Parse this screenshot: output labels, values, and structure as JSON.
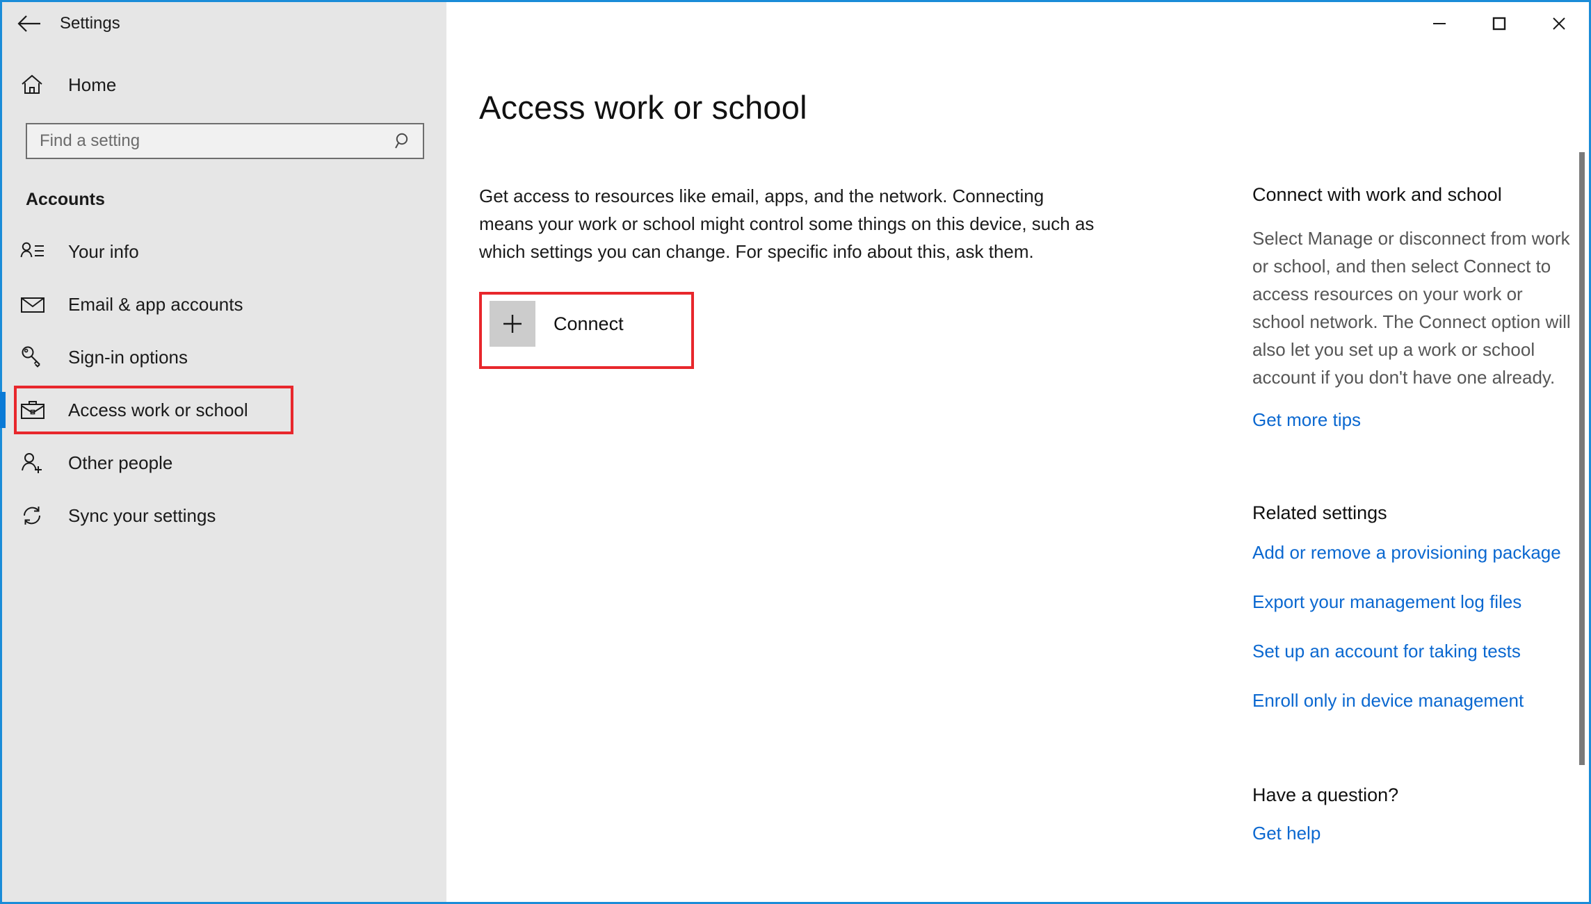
{
  "window": {
    "app_title": "Settings",
    "accent_color": "#1a8cd8",
    "back_icon": "back-arrow-icon",
    "controls": {
      "minimize": "minimize-icon",
      "maximize": "maximize-icon",
      "close": "close-icon"
    }
  },
  "sidebar": {
    "home_label": "Home",
    "home_icon": "home-icon",
    "search": {
      "placeholder": "Find a setting",
      "value": "",
      "icon": "search-icon"
    },
    "section_title": "Accounts",
    "items": [
      {
        "label": "Your info",
        "icon": "user-info-icon",
        "selected": false
      },
      {
        "label": "Email & app accounts",
        "icon": "envelope-icon",
        "selected": false
      },
      {
        "label": "Sign-in options",
        "icon": "key-icon",
        "selected": false
      },
      {
        "label": "Access work or school",
        "icon": "briefcase-icon",
        "selected": true
      },
      {
        "label": "Other people",
        "icon": "add-person-icon",
        "selected": false
      },
      {
        "label": "Sync your settings",
        "icon": "sync-icon",
        "selected": false
      }
    ],
    "selection_color": "#0a7ad6"
  },
  "main": {
    "page_title": "Access work or school",
    "intro": "Get access to resources like email, apps, and the network. Connecting means your work or school might control some things on this device, such as which settings you can change. For specific info about this, ask them.",
    "connect_button": {
      "label": "Connect",
      "icon": "plus-icon"
    }
  },
  "rail": {
    "connect_section": {
      "heading": "Connect with work and school",
      "body": "Select Manage or disconnect from work or school, and then select Connect to access resources on your work or school network. The Connect option will also let you set up a work or school account if you don't have one already.",
      "link": "Get more tips"
    },
    "related_section": {
      "heading": "Related settings",
      "links": [
        "Add or remove a provisioning package",
        "Export your management log files",
        "Set up an account for taking tests",
        "Enroll only in device management"
      ]
    },
    "help_section": {
      "heading": "Have a question?",
      "link": "Get help"
    },
    "link_color": "#0b68d0"
  },
  "annotations": {
    "highlight_color": "#e8272c",
    "boxes": [
      "sidebar-access-work-or-school",
      "connect-button"
    ]
  }
}
